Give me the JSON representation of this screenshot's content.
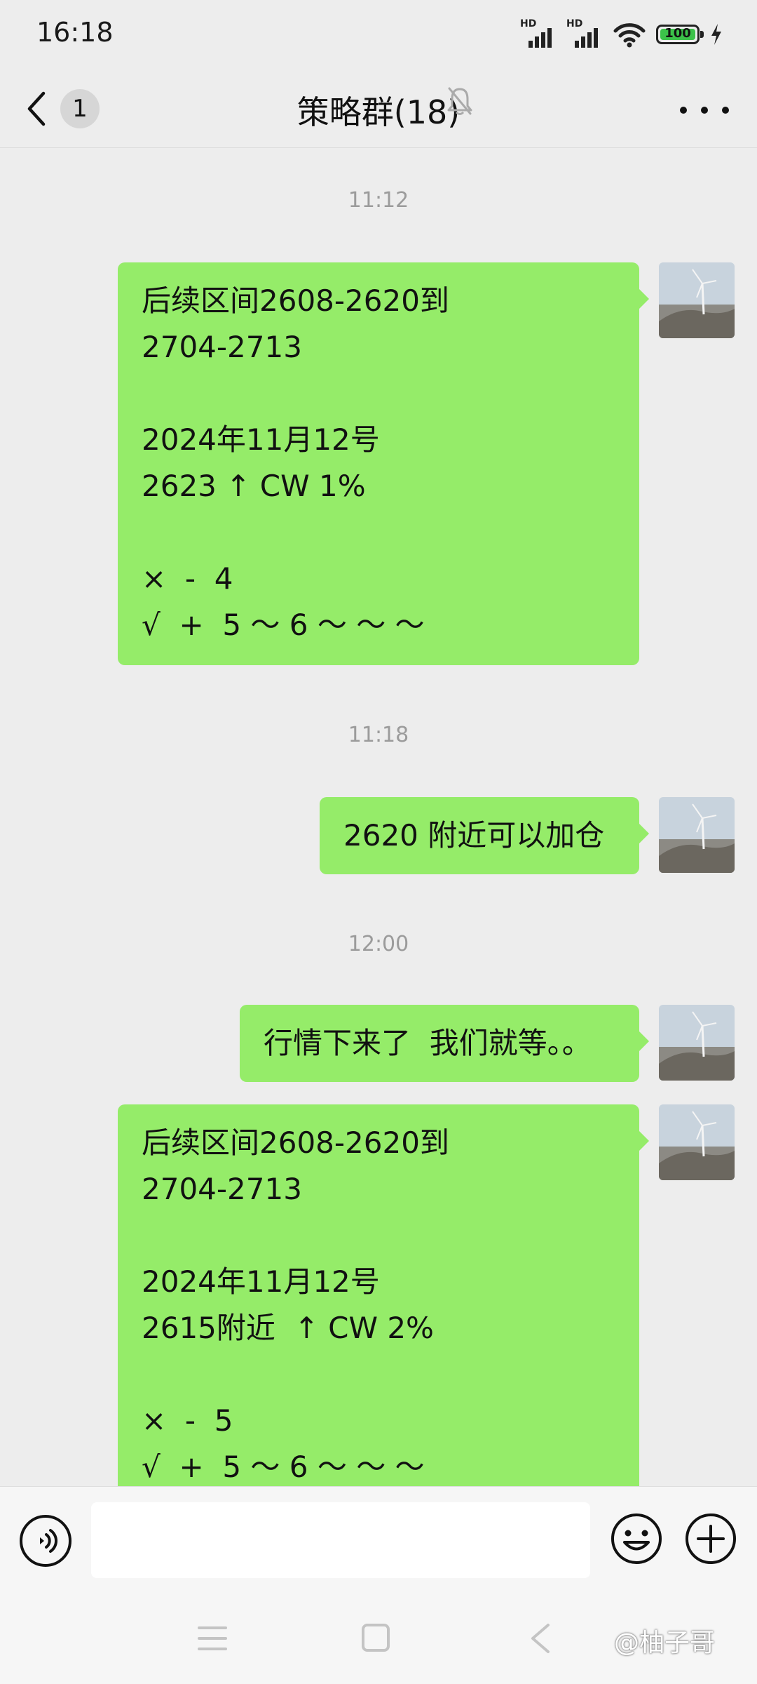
{
  "status_bar": {
    "time": "16:18",
    "signal_label_1": "HD",
    "signal_label_2": "HD",
    "battery_level": "100",
    "icons": [
      "signal-icon",
      "wifi-icon",
      "battery-icon",
      "charging-icon"
    ]
  },
  "header": {
    "back_icon": "chevron-left-icon",
    "unread_count": "1",
    "title": "策略群(18)",
    "mute_icon": "bell-mute-icon",
    "more_icon": "more-horizontal-icon"
  },
  "messages": [
    {
      "type": "time",
      "text": "11:12"
    },
    {
      "type": "text",
      "sender": "self",
      "text": "后续区间2608-2620到\n2704-2713\n\n2024年11月12号\n2623 ↑ CW 1%\n\n×  -  4\n√  +  5 ～ 6 ～ ～ ～"
    },
    {
      "type": "time",
      "text": "11:18"
    },
    {
      "type": "text",
      "sender": "self",
      "text": "2620 附近可以加仓"
    },
    {
      "type": "time",
      "text": "12:00"
    },
    {
      "type": "text",
      "sender": "self",
      "text": "行情下来了  我们就等。。"
    },
    {
      "type": "text",
      "sender": "self",
      "text": "后续区间2608-2620到\n2704-2713\n\n2024年11月12号\n2615附近  ↑ CW 2%\n\n×  -  5\n√  +  5 ～ 6 ～ ～ ～"
    }
  ],
  "input_bar": {
    "value": "",
    "voice_icon": "voice-icon",
    "emoji_icon": "emoji-icon",
    "plus_icon": "plus-circle-icon"
  },
  "nav_bar": {
    "icons": [
      "menu-icon",
      "home-icon",
      "back-icon"
    ]
  },
  "watermark": "@柚子哥",
  "colors": {
    "background": "#ededed",
    "bubble_self": "#95ec69",
    "timestamp": "#9b9b9b",
    "battery_fill": "#3cc24a"
  }
}
